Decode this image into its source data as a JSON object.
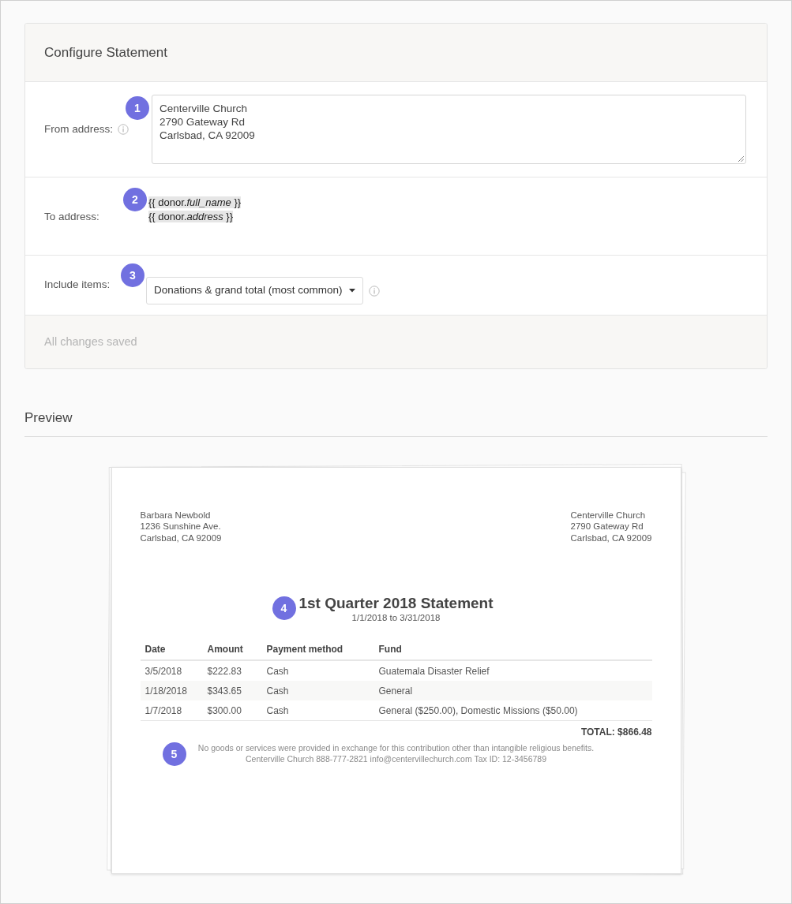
{
  "header": {
    "title": "Configure Statement"
  },
  "form": {
    "fields": [
      {
        "kind": "textarea",
        "label": "From address:",
        "info": true,
        "callout": "1",
        "lines": [
          "Centerville Church",
          "2790 Gateway Rd",
          "Carlsbad, CA 92009"
        ]
      },
      {
        "kind": "template",
        "label": "To address:",
        "info": false,
        "callout": "2",
        "lines": [
          "{{ donor.*full_name* }}",
          "{{ donor.*address* }}"
        ]
      },
      {
        "kind": "select",
        "label": "Include items:",
        "info": false,
        "callout": "3",
        "value": "Donations & grand total (most common)",
        "value_info": true
      }
    ]
  },
  "status": "All changes saved",
  "preview": {
    "heading": "Preview",
    "statement": {
      "to_lines": [
        "Barbara Newbold",
        "1236 Sunshine Ave.",
        "Carlsbad, CA 92009"
      ],
      "from_lines": [
        "Centerville Church",
        "2790 Gateway Rd",
        "Carlsbad, CA 92009"
      ],
      "title_callout": "4",
      "title": "1st Quarter 2018 Statement",
      "period": "1/1/2018 to 3/31/2018",
      "columns": [
        "Date",
        "Amount",
        "Payment method",
        "Fund"
      ],
      "rows": [
        {
          "cells": [
            "3/5/2018",
            "$222.83",
            "Cash",
            "Guatemala Disaster Relief"
          ]
        },
        {
          "cells": [
            "1/18/2018",
            "$343.65",
            "Cash",
            "General"
          ]
        },
        {
          "cells": [
            "1/7/2018",
            "$300.00",
            "Cash",
            "General ($250.00), Domestic Missions ($50.00)"
          ]
        }
      ],
      "total": "TOTAL: $866.48",
      "footer_callout": "5",
      "disclaimer": "No goods or services were provided in exchange for this contribution other than intangible religious benefits.",
      "contact": "Centerville Church 888-777-2821 info@centervillechurch.com Tax ID: 12-3456789"
    }
  }
}
